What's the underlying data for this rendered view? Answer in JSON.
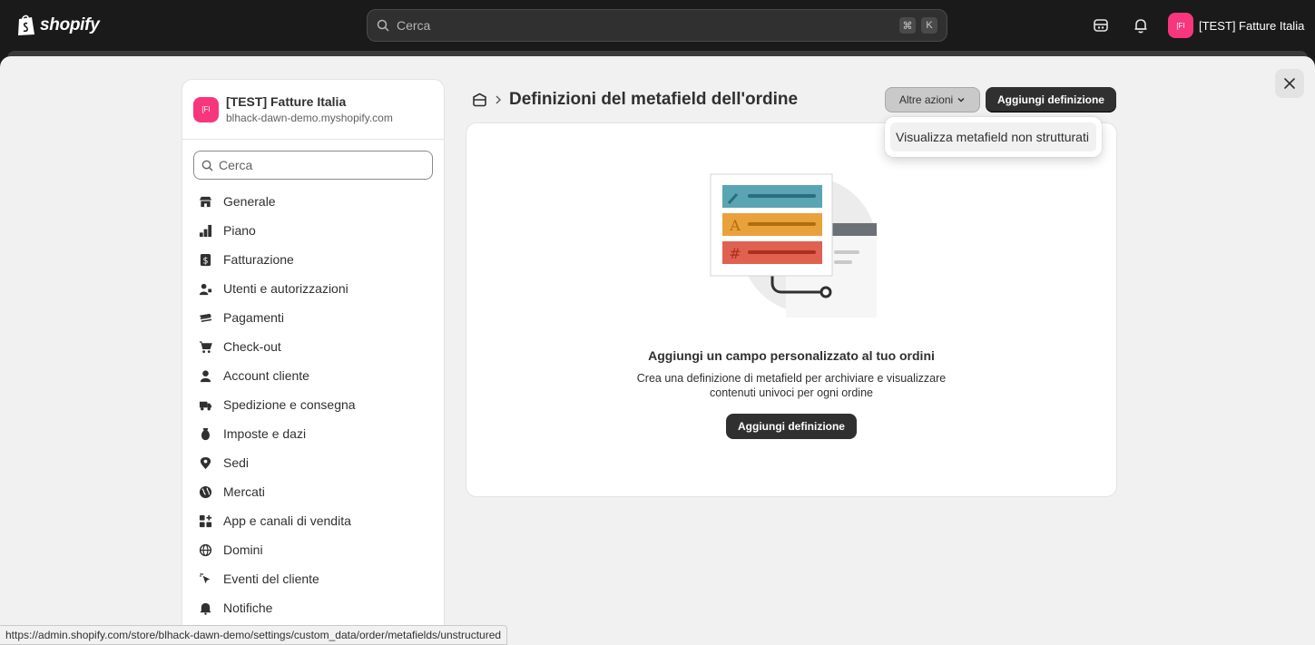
{
  "topbar": {
    "logo_text": "shopify",
    "search_placeholder": "Cerca",
    "shortcut_cmd": "⌘",
    "shortcut_key": "K",
    "store_avatar": "[FI",
    "store_name": "[TEST] Fatture Italia"
  },
  "sidebar": {
    "avatar": "[FI",
    "store_title": "[TEST] Fatture Italia",
    "store_domain": "blhack-dawn-demo.myshopify.com",
    "search_placeholder": "Cerca",
    "items": [
      {
        "label": "Generale",
        "icon": "store-icon"
      },
      {
        "label": "Piano",
        "icon": "plan-icon"
      },
      {
        "label": "Fatturazione",
        "icon": "billing-icon"
      },
      {
        "label": "Utenti e autorizzazioni",
        "icon": "users-icon"
      },
      {
        "label": "Pagamenti",
        "icon": "payments-icon"
      },
      {
        "label": "Check-out",
        "icon": "cart-icon"
      },
      {
        "label": "Account cliente",
        "icon": "person-icon"
      },
      {
        "label": "Spedizione e consegna",
        "icon": "truck-icon"
      },
      {
        "label": "Imposte e dazi",
        "icon": "taxes-icon"
      },
      {
        "label": "Sedi",
        "icon": "location-icon"
      },
      {
        "label": "Mercati",
        "icon": "globe-icon"
      },
      {
        "label": "App e canali di vendita",
        "icon": "apps-icon"
      },
      {
        "label": "Domini",
        "icon": "domain-icon"
      },
      {
        "label": "Eventi del cliente",
        "icon": "cursor-icon"
      },
      {
        "label": "Notifiche",
        "icon": "bell-icon"
      }
    ]
  },
  "main": {
    "page_title": "Definizioni del metafield dell'ordine",
    "more_actions_label": "Altre azioni",
    "add_definition_label": "Aggiungi definizione",
    "dropdown_item": "Visualizza metafield non strutturati",
    "empty_title": "Aggiungi un campo personalizzato al tuo ordini",
    "empty_desc": "Crea una definizione di metafield per archiviare e visualizzare contenuti univoci per ogni ordine",
    "empty_button": "Aggiungi definizione"
  },
  "statusbar": {
    "url": "https://admin.shopify.com/store/blhack-dawn-demo/settings/custom_data/order/metafields/unstructured"
  },
  "colors": {
    "accent": "#303030",
    "avatar": "#f7367e",
    "teal": "#5aa5b4",
    "orange": "#e9a23b",
    "red": "#e0614f"
  }
}
